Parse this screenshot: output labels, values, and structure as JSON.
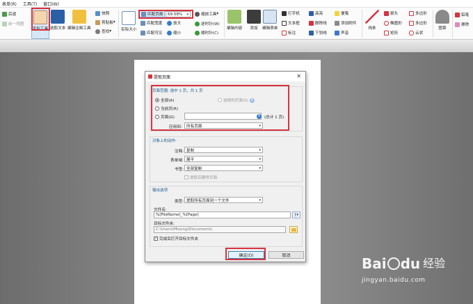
{
  "menubar": {
    "items": [
      "表单(R)",
      "工具(T)",
      "窗口(W)"
    ]
  },
  "toolbar": {
    "back": "后退",
    "prev_view": "前一视图",
    "hand_tool": "手形工具",
    "select_text": "选取文本",
    "edit_annot": "编辑注释工具",
    "snapshot": "快照",
    "clipboard": "剪贴板",
    "find": "查找",
    "actual_size": "实际大小",
    "fit_page": "匹配页面",
    "fit_width": "匹配宽度",
    "fit_visible": "匹配可见",
    "zoom_value": "69.58%",
    "zoom_tool": "缩放工具",
    "zoom_in": "放大",
    "zoom_out": "缩小",
    "rotate_cw": "逆时针(W)",
    "rotate_ccw": "顺时针(C)",
    "edit_content": "编辑内容",
    "add": "添加",
    "edit_form": "编辑表单",
    "typewriter": "打字机",
    "textbox": "文本框",
    "callout": "标注",
    "highlight": "高亮",
    "strikeout": "删除线",
    "underline": "下划线",
    "note": "便笺",
    "attach": "添加附件",
    "sound": "声音",
    "line": "线条",
    "arrow": "箭头",
    "ellipse": "椭圆形",
    "rect": "矩形",
    "polygon": "多边形",
    "polyline": "多边形",
    "cloud": "云状",
    "stamp": "图章",
    "pencil": "铅笔",
    "eraser": "擦除"
  },
  "dialog": {
    "title": "提取页面",
    "close": "✕",
    "range_title": "页面范围: 选中 1 页，共 1 页",
    "all": "全部(A)",
    "selected_pages": "选择的页面(S)",
    "current_page": "当前页(R)",
    "pages": "页面(G)",
    "pages_value": "",
    "total": "(总计 1 页)",
    "apply_to_label": "应用到:",
    "apply_to_value": "所有页面",
    "actions_title": "对象上的动作:",
    "comments_label": "注释:",
    "comments_value": "复制",
    "form_label": "表单域:",
    "form_value": "展平",
    "bookmarks_label": "书签:",
    "bookmarks_value": "全部复制",
    "delete_after": "提取后删除页面",
    "output_title": "输出选项",
    "type_label": "类型:",
    "type_value": "提取所有页面到一个文件",
    "filename_label": "文件名:",
    "filename_value": "%[FileName]_%[Page]",
    "folder_label": "目标文件夹:",
    "folder_value": "C:\\Users\\Mloong\\Documents\\",
    "open_after": "完成后打开目标文件夹",
    "ok": "确定(O)",
    "cancel": "取消"
  },
  "watermark": {
    "brand": "Bai",
    "du": "du",
    "jingyan": "经验",
    "url": "jingyan.baidu.com"
  }
}
